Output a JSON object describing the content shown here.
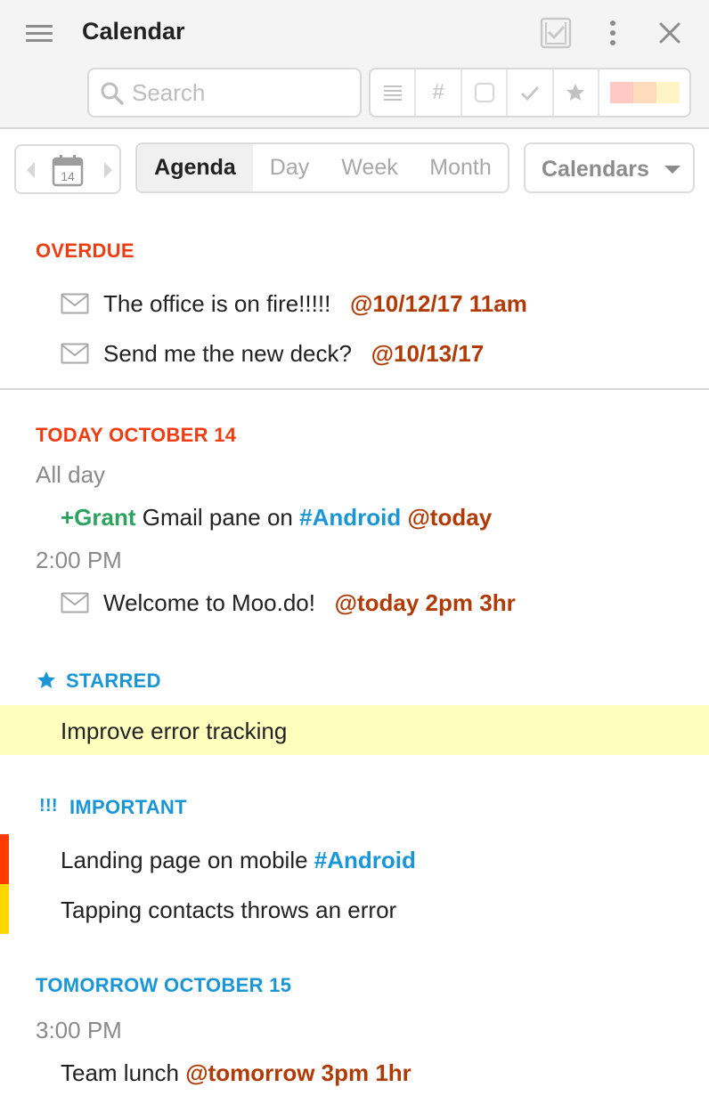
{
  "header": {
    "title": "Calendar",
    "search_placeholder": "Search",
    "filters": [
      "list",
      "#",
      "checkbox",
      "check",
      "star",
      "colors"
    ],
    "filter_colors": [
      "#ffc9c4",
      "#ffdcbb",
      "#fff5c4"
    ]
  },
  "toolbar": {
    "date_number": "14",
    "tabs": [
      "Agenda",
      "Day",
      "Week",
      "Month"
    ],
    "active_tab": "Agenda",
    "calendars_label": "Calendars"
  },
  "overdue": {
    "heading": "OVERDUE",
    "items": [
      {
        "text": "The office is on fire!!!!!",
        "date": "@10/12/17 11am"
      },
      {
        "text": "Send me the new deck?",
        "date": "@10/13/17"
      }
    ]
  },
  "today": {
    "heading": "TODAY OCTOBER 14",
    "all_day_label": "All day",
    "all_day_item": {
      "person": "+Grant",
      "text": "Gmail pane on",
      "hashtag": "#Android",
      "date": "@today"
    },
    "time_label": "2:00 PM",
    "timed_item": {
      "text": "Welcome to Moo.do!",
      "date": "@today 2pm 3hr"
    }
  },
  "starred": {
    "heading": "STARRED",
    "items": [
      {
        "text": "Improve error tracking"
      }
    ]
  },
  "important": {
    "marker": "!!!",
    "heading": "IMPORTANT",
    "items": [
      {
        "text": "Landing page on mobile",
        "hashtag": "#Android",
        "priority_color": "#ff3b00"
      },
      {
        "text": "Tapping contacts throws an error",
        "priority_color": "#ffd600"
      }
    ]
  },
  "tomorrow": {
    "heading": "TOMORROW OCTOBER 15",
    "time_label": "3:00 PM",
    "item": {
      "text": "Team lunch",
      "date": "@tomorrow 3pm 1hr"
    }
  },
  "colors": {
    "overdue_red": "#f03c12",
    "accent_blue": "#1a96d6",
    "date_tag": "#b03b06",
    "person_tag": "#2ea35f",
    "starred_bg": "#ffffbd"
  }
}
